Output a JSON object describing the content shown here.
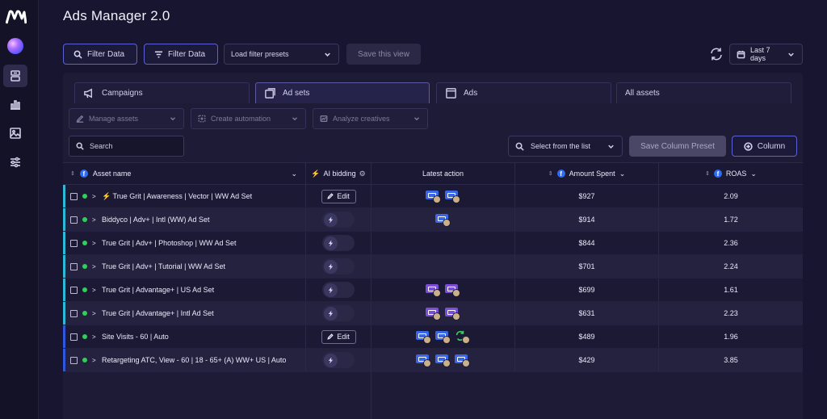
{
  "app": {
    "title": "Ads Manager 2.0"
  },
  "colors": {
    "accent": "#5d61d6",
    "fb_blue": "#2d6cf3",
    "status_green": "#2fd05a",
    "bar_cyan": "#2bb9d6",
    "bar_blue": "#3056e0"
  },
  "toolbar": {
    "filter1_label": "Filter Data",
    "filter2_label": "Filter Data",
    "presets_label": "Load filter presets",
    "save_view_label": "Save this view",
    "date_range_label": "Last 7 days"
  },
  "tabs": [
    {
      "label": "Campaigns",
      "icon": "megaphone-icon"
    },
    {
      "label": "Ad sets",
      "icon": "ad-sets-icon",
      "active": true
    },
    {
      "label": "Ads",
      "icon": "square-icon"
    },
    {
      "label": "All assets"
    }
  ],
  "actions": {
    "manage_label": "Manage assets",
    "automation_label": "Create automation",
    "analyze_label": "Analyze creatives",
    "search_placeholder": "Search",
    "select_list_label": "Select from the list",
    "save_preset_label": "Save Column Preset",
    "column_label": "Column"
  },
  "table": {
    "headers": {
      "asset": "Asset name",
      "ai": "AI bidding",
      "latest": "Latest action",
      "spent": "Amount Spent",
      "roas": "ROAS"
    },
    "edit_label": "Edit",
    "rows": [
      {
        "name": "⚡ True Grit | Awareness | Vector | WW Ad Set",
        "bidding": "edit",
        "actions": [
          "blue",
          "blue"
        ],
        "spent": "$927",
        "roas": "2.09",
        "bar": "cyan"
      },
      {
        "name": "Biddyco | Adv+ | Intl (WW) Ad Set",
        "bidding": "toggle",
        "actions": [
          "blue"
        ],
        "spent": "$914",
        "roas": "1.72",
        "bar": "cyan"
      },
      {
        "name": "True Grit | Adv+ | Photoshop | WW Ad Set",
        "bidding": "toggle",
        "actions": [],
        "spent": "$844",
        "roas": "2.36",
        "bar": "cyan"
      },
      {
        "name": "True Grit | Adv+ | Tutorial | WW Ad Set",
        "bidding": "toggle",
        "actions": [],
        "spent": "$701",
        "roas": "2.24",
        "bar": "cyan"
      },
      {
        "name": "True Grit | Advantage+ | US Ad Set",
        "bidding": "toggle",
        "actions": [
          "purple",
          "purple"
        ],
        "spent": "$699",
        "roas": "1.61",
        "bar": "cyan"
      },
      {
        "name": "True Grit | Advantage+ | Intl Ad Set",
        "bidding": "toggle",
        "actions": [
          "purple",
          "purple"
        ],
        "spent": "$631",
        "roas": "2.23",
        "bar": "cyan"
      },
      {
        "name": "Site Visits - 60 | Auto",
        "bidding": "edit",
        "actions": [
          "blue",
          "blue",
          "refresh"
        ],
        "spent": "$489",
        "roas": "1.96",
        "bar": "blue"
      },
      {
        "name": "Retargeting ATC, View - 60 | 18 - 65+ (A) WW+ US | Auto",
        "bidding": "toggle",
        "actions": [
          "blue",
          "blue",
          "blue"
        ],
        "spent": "$429",
        "roas": "3.85",
        "bar": "blue"
      }
    ]
  }
}
